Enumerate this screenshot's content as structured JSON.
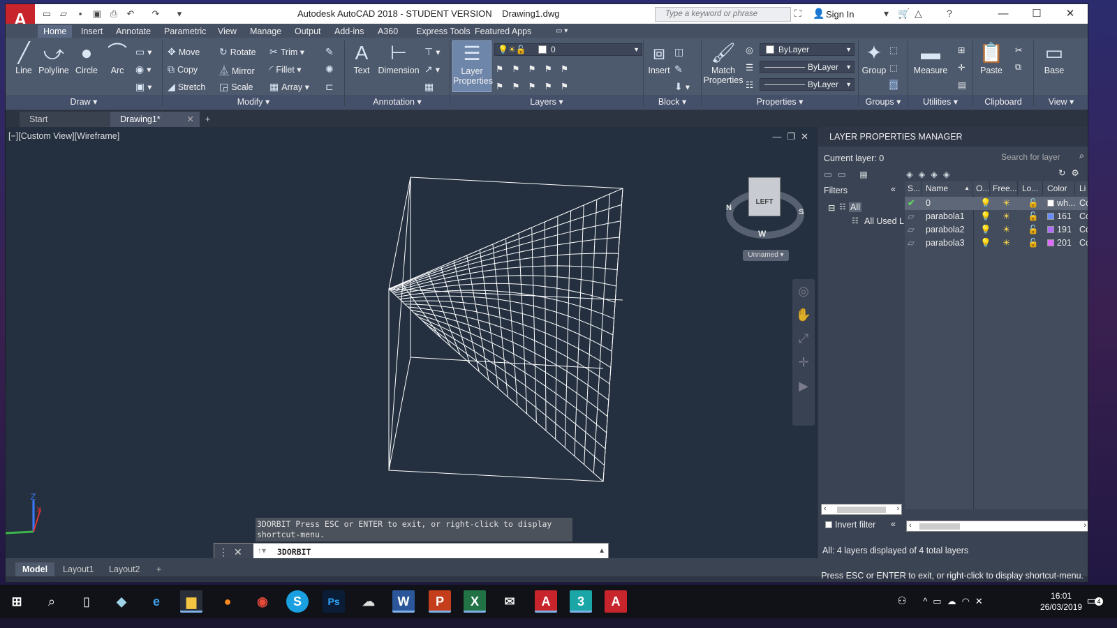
{
  "window": {
    "title": "Autodesk AutoCAD 2018 - STUDENT VERSION",
    "file": "Drawing1.dwg",
    "search_placeholder": "Type a keyword or phrase",
    "signin": "Sign In",
    "app_letter": "A"
  },
  "ribbon_tabs": [
    "Home",
    "Insert",
    "Annotate",
    "Parametric",
    "View",
    "Manage",
    "Output",
    "Add-ins",
    "A360",
    "Express Tools",
    "Featured Apps"
  ],
  "draw": {
    "line": "Line",
    "polyline": "Polyline",
    "circle": "Circle",
    "arc": "Arc",
    "panel": "Draw"
  },
  "modify": {
    "move": "Move",
    "rotate": "Rotate",
    "trim": "Trim",
    "copy": "Copy",
    "mirror": "Mirror",
    "fillet": "Fillet",
    "stretch": "Stretch",
    "scale": "Scale",
    "array": "Array",
    "panel": "Modify"
  },
  "annotation": {
    "text": "Text",
    "dimension": "Dimension",
    "panel": "Annotation"
  },
  "layers": {
    "layer_properties_1": "Layer",
    "layer_properties_2": "Properties",
    "current": "0",
    "panel": "Layers"
  },
  "block": {
    "insert": "Insert",
    "panel": "Block"
  },
  "properties": {
    "match_1": "Match",
    "match_2": "Properties",
    "color": "ByLayer",
    "linetype": "ByLayer",
    "lineweight": "ByLayer",
    "panel": "Properties"
  },
  "groups": {
    "group": "Group",
    "panel": "Groups"
  },
  "utilities": {
    "measure": "Measure",
    "panel": "Utilities"
  },
  "clipboard": {
    "paste": "Paste",
    "panel": "Clipboard"
  },
  "view": {
    "base": "Base",
    "panel": "View"
  },
  "file_tabs": {
    "start": "Start",
    "drawing": "Drawing1*"
  },
  "viewport": {
    "label": "[−][Custom View][Wireframe]",
    "viewcube_face": "LEFT",
    "compass_n": "N",
    "compass_s": "S",
    "compass_w": "W",
    "viewcube_menu": "Unnamed"
  },
  "command": {
    "history": "3DORBIT Press ESC or ENTER to exit, or right-click to display shortcut-menu.",
    "current": "3DORBIT"
  },
  "lpm": {
    "title": "LAYER PROPERTIES MANAGER",
    "current_layer": "Current layer: 0",
    "search_placeholder": "Search for layer",
    "filters": "Filters",
    "filter_all": "All",
    "filter_used": "All Used L",
    "invert_filter": "Invert filter",
    "footer": "All: 4 layers displayed of 4 total layers",
    "headers": {
      "status": "S...",
      "name": "Name",
      "on": "O...",
      "freeze": "Free...",
      "lock": "Lo...",
      "color": "Color",
      "linetype": "Li"
    },
    "rows": [
      {
        "name": "0",
        "color": "wh...",
        "color_hex": "#ffffff",
        "lt": "Co"
      },
      {
        "name": "parabola1",
        "color": "161",
        "color_hex": "#6b8cff",
        "lt": "Co"
      },
      {
        "name": "parabola2",
        "color": "191",
        "color_hex": "#b06bff",
        "lt": "Co"
      },
      {
        "name": "parabola3",
        "color": "201",
        "color_hex": "#e06bff",
        "lt": "Co"
      }
    ]
  },
  "layout_tabs": [
    "Model",
    "Layout1",
    "Layout2"
  ],
  "status_message": "Press ESC or ENTER to exit, or right-click to display shortcut-menu.",
  "clock": {
    "time": "16:01",
    "date": "26/03/2019"
  },
  "notif_count": "4"
}
